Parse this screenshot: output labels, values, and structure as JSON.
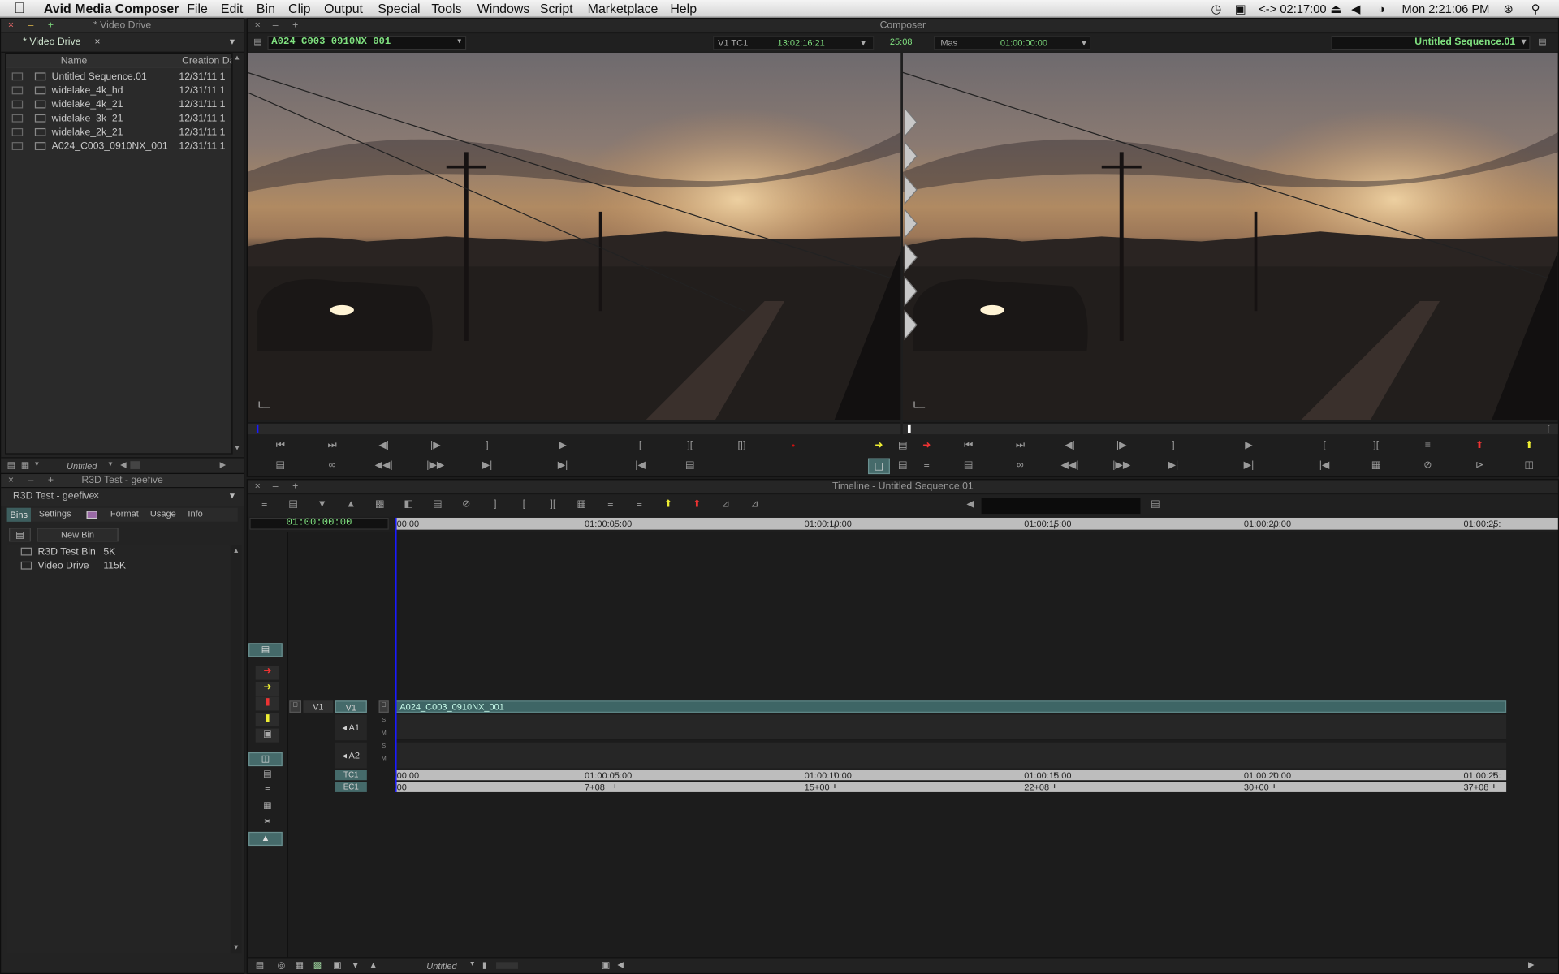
{
  "menubar": {
    "app": "Avid Media Composer",
    "items": [
      "File",
      "Edit",
      "Bin",
      "Clip",
      "Output",
      "Special",
      "Tools",
      "Windows",
      "Script",
      "Marketplace",
      "Help"
    ],
    "status": {
      "timecode": "<-> 02:17:00",
      "clock": "Mon 2:21:06 PM"
    }
  },
  "colors": {
    "accent_green": "#7fe07f",
    "clip_teal": "#3e6565",
    "playhead": "#1a1aff",
    "record_red": "#d01010"
  },
  "bin_window": {
    "title": "* Video Drive",
    "tab": "* Video Drive",
    "columns": [
      "Name",
      "Creation Date"
    ],
    "rows": [
      {
        "name": "Untitled Sequence.01",
        "date": "12/31/11 1",
        "icon": "sequence-icon"
      },
      {
        "name": "widelake_4k_hd",
        "date": "12/31/11 1",
        "icon": "clip-icon"
      },
      {
        "name": "widelake_4k_21",
        "date": "12/31/11 1",
        "icon": "clip-icon"
      },
      {
        "name": "widelake_3k_21",
        "date": "12/31/11 1",
        "icon": "clip-icon"
      },
      {
        "name": "widelake_2k_21",
        "date": "12/31/11 1",
        "icon": "clip-icon"
      },
      {
        "name": "A024_C003_0910NX_001",
        "date": "12/31/11 1",
        "icon": "clip-icon"
      }
    ],
    "footer_view": "Untitled"
  },
  "project_window": {
    "title": "R3D Test - geefive",
    "tab": "R3D Test - geefive",
    "tabs": [
      "Bins",
      "Settings",
      "Format",
      "Usage",
      "Info"
    ],
    "new_bin": "New Bin",
    "bins": [
      {
        "name": "R3D Test Bin",
        "size": "5K"
      },
      {
        "name": "Video Drive",
        "size": "115K"
      }
    ]
  },
  "composer": {
    "title": "Composer",
    "source_clip": "A024 C003 0910NX 001",
    "track_label": "V1 TC1",
    "source_tc": "13:02:16:21",
    "duration": "25:08",
    "mas_label": "Mas",
    "record_tc": "01:00:00:00",
    "sequence": "Untitled Sequence.01"
  },
  "timeline": {
    "title": "Timeline - Untitled Sequence.01",
    "master_tc": "01:00:00:00",
    "ruler": [
      "00:00",
      "01:00:05:00",
      "01:00:10:00",
      "01:00:15:00",
      "01:00:20:00",
      "01:00:25:"
    ],
    "tracks": {
      "v1_src": "V1",
      "v1": "V1",
      "a1": "A1",
      "a2": "A2",
      "tc": "TC1",
      "ec": "EC1"
    },
    "clip_name": "A024_C003_0910NX_001",
    "tc_track": [
      "00:00",
      "01:00:05:00",
      "01:00:10:00",
      "01:00:15:00",
      "01:00:20:00",
      "01:00:25:"
    ],
    "ec_track": [
      "00",
      "7+08",
      "15+00",
      "22+08",
      "30+00",
      "37+08"
    ],
    "footer_view": "Untitled"
  }
}
